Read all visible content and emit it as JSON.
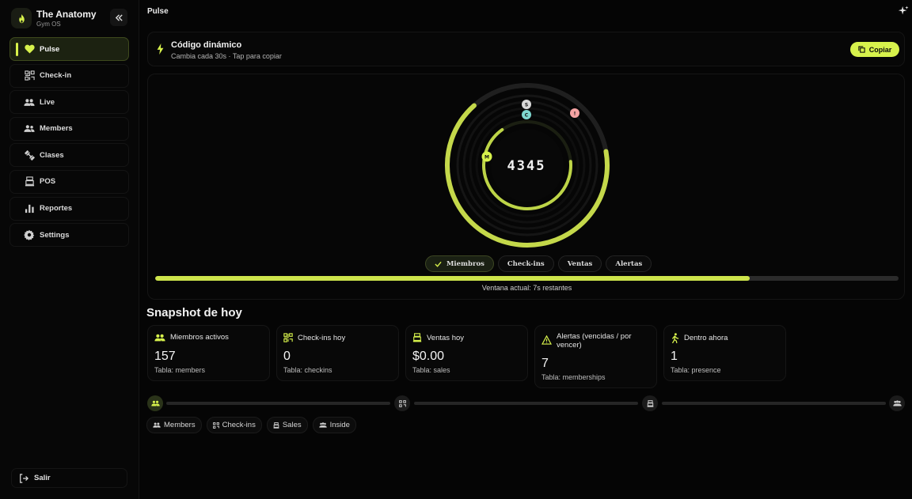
{
  "brand": {
    "title": "The Anatomy",
    "subtitle": "Gym OS"
  },
  "sidebar": {
    "items": [
      {
        "label": "Pulse",
        "icon": "heart-icon",
        "active": true
      },
      {
        "label": "Check-in",
        "icon": "qr-icon"
      },
      {
        "label": "Live",
        "icon": "users-icon"
      },
      {
        "label": "Members",
        "icon": "members-icon"
      },
      {
        "label": "Clases",
        "icon": "dumbbell-icon"
      },
      {
        "label": "POS",
        "icon": "register-icon"
      },
      {
        "label": "Reportes",
        "icon": "bar-chart-icon"
      },
      {
        "label": "Settings",
        "icon": "gear-icon"
      }
    ],
    "logout_label": "Salir"
  },
  "header": {
    "title": "Pulse"
  },
  "code_card": {
    "title": "Código dinámico",
    "subtitle": "Cambia cada 30s · Tap para copiar",
    "copy_label": "Copiar"
  },
  "pulse": {
    "code": "4345",
    "markers": [
      {
        "letter": "S",
        "color": "#d9d9d9"
      },
      {
        "letter": "C",
        "color": "#7fd8d0"
      },
      {
        "letter": "!",
        "color": "#f5a3a3"
      },
      {
        "letter": "M",
        "color": "#d7f24c"
      }
    ],
    "chips": [
      {
        "label": "Miembros",
        "active": true
      },
      {
        "label": "Check-ins",
        "active": false
      },
      {
        "label": "Ventas",
        "active": false
      },
      {
        "label": "Alertas",
        "active": false
      }
    ],
    "progress": 0.8,
    "window_text": "Ventana actual: 7s restantes"
  },
  "snapshot": {
    "title": "Snapshot de hoy",
    "stats": [
      {
        "label": "Miembros activos",
        "value": "157",
        "sub": "Tabla: members",
        "icon": "users-icon"
      },
      {
        "label": "Check-ins hoy",
        "value": "0",
        "sub": "Tabla: checkins",
        "icon": "qr-icon"
      },
      {
        "label": "Ventas hoy",
        "value": "$0.00",
        "sub": "Tabla: sales",
        "icon": "register-icon"
      },
      {
        "label": "Alertas (vencidas / por vencer)",
        "value": "7",
        "sub": "Tabla: memberships",
        "icon": "warning-icon"
      },
      {
        "label": "Dentro ahora",
        "value": "1",
        "sub": "Tabla: presence",
        "icon": "walking-icon"
      }
    ]
  },
  "flow": {
    "pills": [
      {
        "label": "Members",
        "icon": "users-icon"
      },
      {
        "label": "Check-ins",
        "icon": "qr-icon"
      },
      {
        "label": "Sales",
        "icon": "register-icon"
      },
      {
        "label": "Inside",
        "icon": "group-icon"
      }
    ]
  },
  "colors": {
    "accent": "#d7f24c",
    "background": "#050505",
    "card": "#070707"
  }
}
